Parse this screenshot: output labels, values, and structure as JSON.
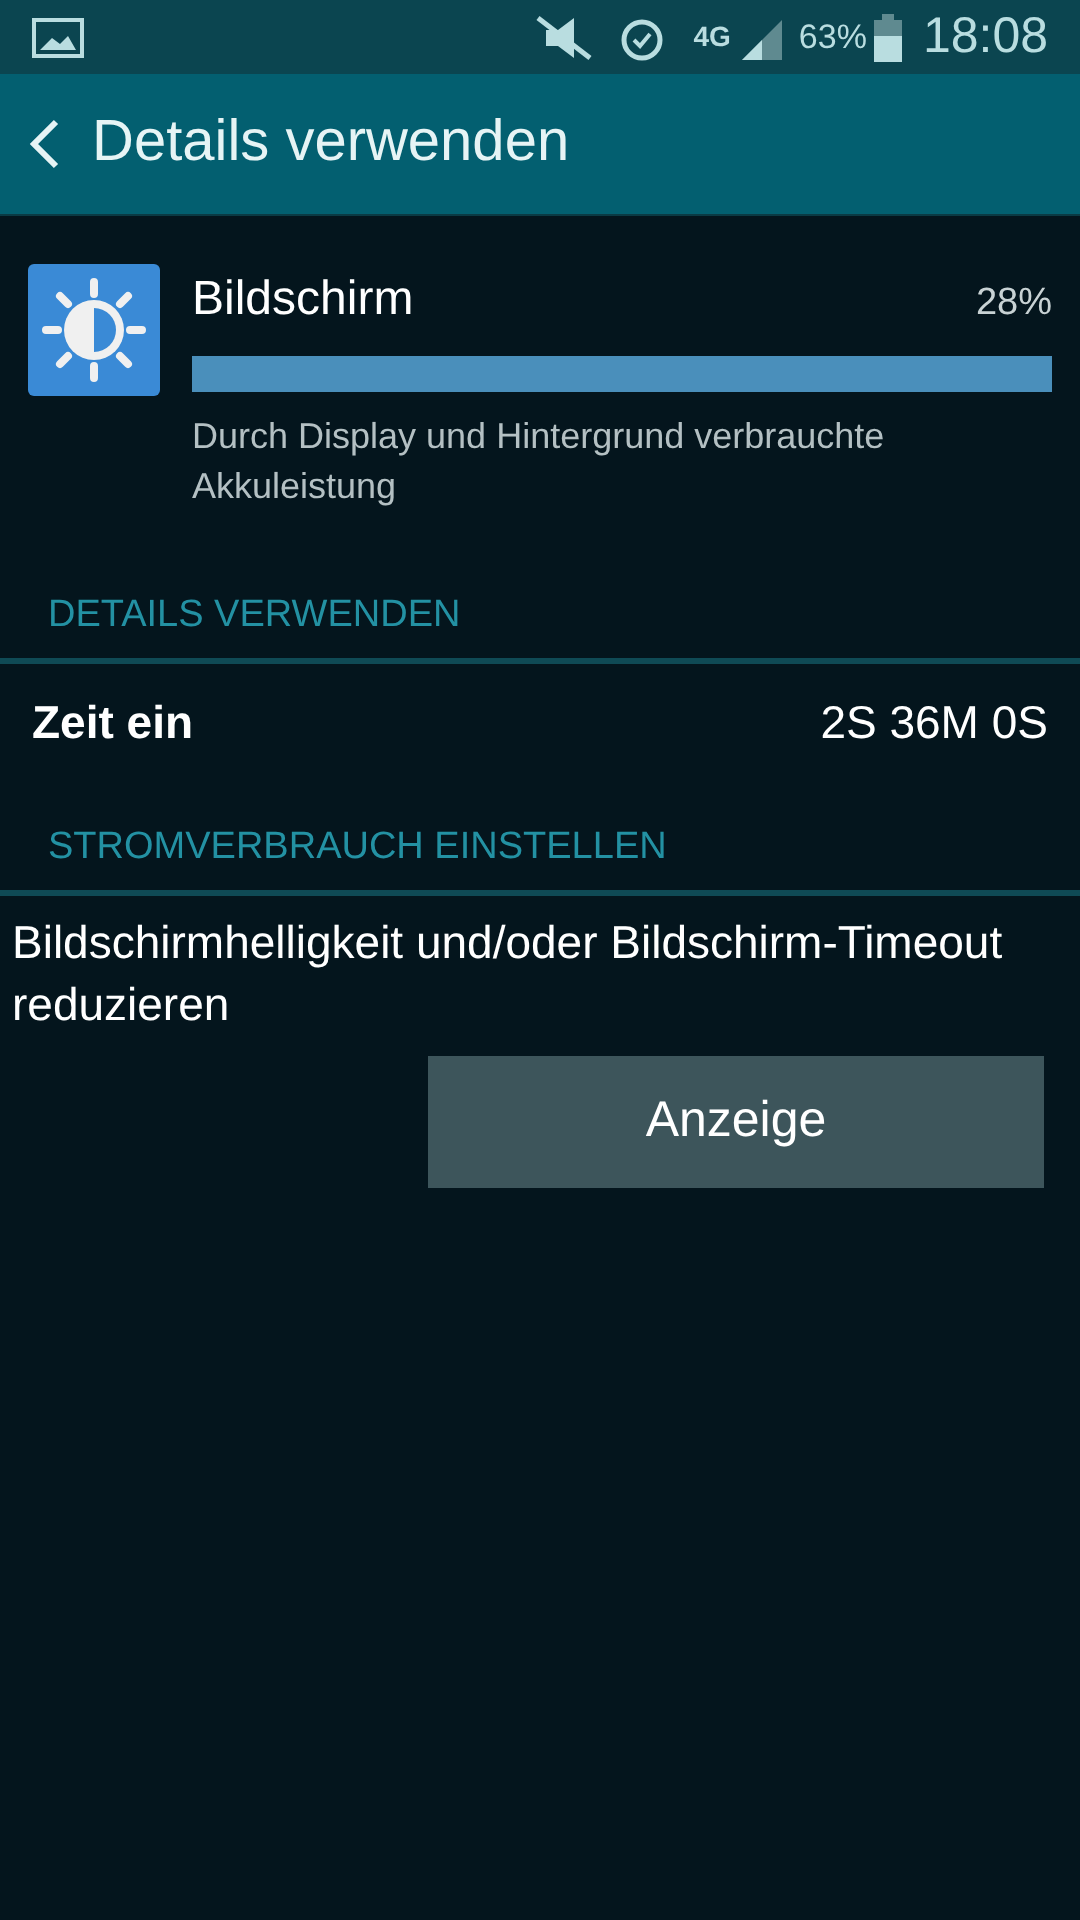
{
  "status_bar": {
    "battery": "63%",
    "time": "18:08",
    "network": "4G"
  },
  "app_bar": {
    "title": "Details verwenden"
  },
  "app_usage": {
    "name": "Bildschirm",
    "percent": "28%",
    "level": 1,
    "description": "Durch Display und Hintergrund verbrauchte Akkuleistung"
  },
  "sections": [
    {
      "header": "DETAILS VERWENDEN",
      "rows": [
        {
          "kind": "stat",
          "label": "Zeit ein",
          "value": "2S 36M 0S"
        }
      ]
    },
    {
      "header": "STROMVERBRAUCH EINSTELLEN",
      "rows": [
        {
          "kind": "action",
          "text": "Bildschirmhelligkeit und/oder Bildschirm-Timeout reduzieren",
          "button": "Anzeige"
        }
      ]
    }
  ]
}
